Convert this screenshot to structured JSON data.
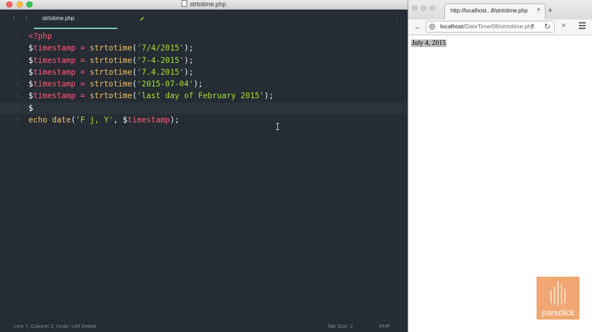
{
  "editor": {
    "window_title": "strtotime.php",
    "tab_label": "strtotime.php",
    "lines": [
      {
        "n": "1",
        "tokens": [
          {
            "t": "<?php",
            "c": "c-tag"
          }
        ]
      },
      {
        "n": "2",
        "tokens": [
          {
            "t": "$",
            "c": "c-dollar"
          },
          {
            "t": "timestamp",
            "c": "c-var"
          },
          {
            "t": " = ",
            "c": "c-op"
          },
          {
            "t": "strtotime",
            "c": "c-fn"
          },
          {
            "t": "(",
            "c": "c-plain"
          },
          {
            "t": "'7/4/2015'",
            "c": "c-str"
          },
          {
            "t": ");",
            "c": "c-plain"
          }
        ]
      },
      {
        "n": "3",
        "tokens": [
          {
            "t": "$",
            "c": "c-dollar"
          },
          {
            "t": "timestamp",
            "c": "c-var"
          },
          {
            "t": " = ",
            "c": "c-op"
          },
          {
            "t": "strtotime",
            "c": "c-fn"
          },
          {
            "t": "(",
            "c": "c-plain"
          },
          {
            "t": "'7-4-2015'",
            "c": "c-str"
          },
          {
            "t": ");",
            "c": "c-plain"
          }
        ]
      },
      {
        "n": "4",
        "tokens": [
          {
            "t": "$",
            "c": "c-dollar"
          },
          {
            "t": "timestamp",
            "c": "c-var"
          },
          {
            "t": " = ",
            "c": "c-op"
          },
          {
            "t": "strtotime",
            "c": "c-fn"
          },
          {
            "t": "(",
            "c": "c-plain"
          },
          {
            "t": "'7.4.2015'",
            "c": "c-str"
          },
          {
            "t": ");",
            "c": "c-plain"
          }
        ]
      },
      {
        "n": "5",
        "tokens": [
          {
            "t": "$",
            "c": "c-dollar"
          },
          {
            "t": "timestamp",
            "c": "c-var"
          },
          {
            "t": " = ",
            "c": "c-op"
          },
          {
            "t": "strtotime",
            "c": "c-fn"
          },
          {
            "t": "(",
            "c": "c-plain"
          },
          {
            "t": "'2015-07-04'",
            "c": "c-str"
          },
          {
            "t": ");",
            "c": "c-plain"
          }
        ]
      },
      {
        "n": "6",
        "tokens": [
          {
            "t": "$",
            "c": "c-dollar"
          },
          {
            "t": "timestamp",
            "c": "c-var"
          },
          {
            "t": " = ",
            "c": "c-op"
          },
          {
            "t": "strtotime",
            "c": "c-fn"
          },
          {
            "t": "(",
            "c": "c-plain"
          },
          {
            "t": "'last day of February 2015'",
            "c": "c-str"
          },
          {
            "t": ");",
            "c": "c-plain"
          }
        ]
      },
      {
        "n": "7",
        "active": true,
        "tokens": [
          {
            "t": "$",
            "c": "c-dollar"
          }
        ]
      },
      {
        "n": "8",
        "tokens": [
          {
            "t": "echo ",
            "c": "c-kw"
          },
          {
            "t": "date",
            "c": "c-fn"
          },
          {
            "t": "(",
            "c": "c-plain"
          },
          {
            "t": "'F j, Y'",
            "c": "c-str"
          },
          {
            "t": ", ",
            "c": "c-plain"
          },
          {
            "t": "$",
            "c": "c-dollar"
          },
          {
            "t": "timestamp",
            "c": "c-var"
          },
          {
            "t": ");",
            "c": "c-plain"
          }
        ]
      }
    ],
    "status": {
      "position": "Line 7, Column 2; Undo: Left Delete",
      "tab_size": "Tab Size: 2",
      "language": "PHP"
    }
  },
  "browser": {
    "tab_title": "http://localhost...8/strtotime.php",
    "url_host": "localhost",
    "url_path": "/DateTime/08/strtotime.php",
    "page_output": "July 4, 2015"
  },
  "logo": {
    "text": "parsclick"
  }
}
